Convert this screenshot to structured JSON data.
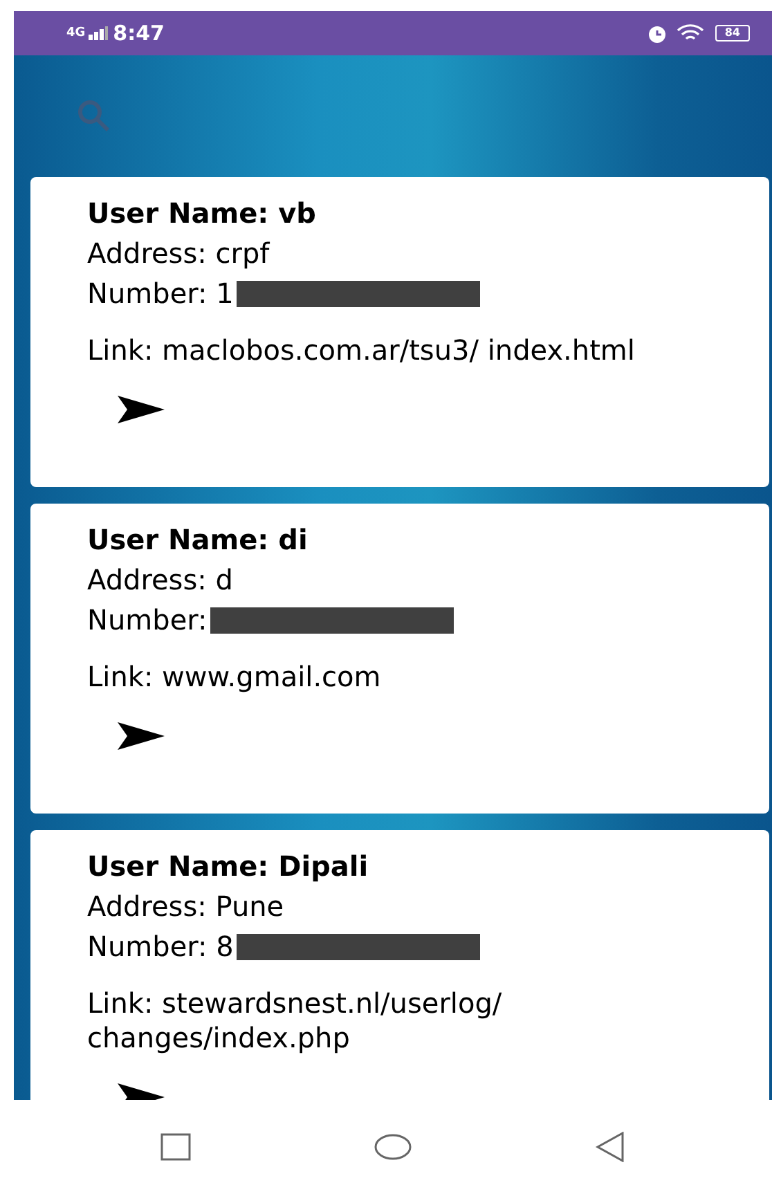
{
  "status_bar": {
    "network": "4G",
    "time": "8:47",
    "battery": "84"
  },
  "cards": [
    {
      "user_name": "User Name: vb",
      "address": "Address: crpf",
      "number": "Number: 1",
      "link": "Link: maclobos.com.ar/tsu3/ index.html"
    },
    {
      "user_name": "User Name: di",
      "address": "Address: d",
      "number": "Number:",
      "link": "Link: www.gmail.com"
    },
    {
      "user_name": "User Name: Dipali",
      "address": "Address: Pune",
      "number": "Number: 8",
      "link": "Link: stewardsnest.nl/userlog/ changes/index.php"
    }
  ]
}
